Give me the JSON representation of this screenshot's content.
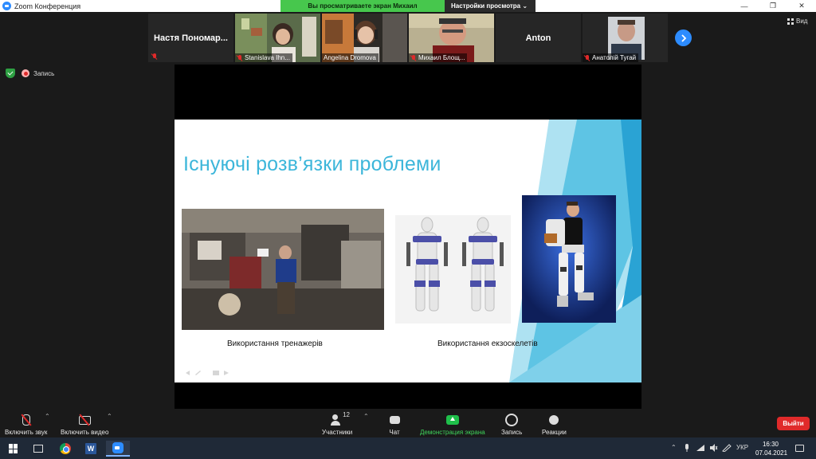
{
  "window": {
    "title": "Zoom Конференция",
    "minimize": "—",
    "maximize": "❐",
    "close": "✕"
  },
  "share_banner": {
    "text": "Вы просматриваете экран Михаил Блощицын",
    "view_options": "Настройки просмотра ⌄"
  },
  "participants": [
    {
      "name": "Настя Пономар..."
    },
    {
      "name": "Stanislava Ihn..."
    },
    {
      "name": "Angelina Dromova"
    },
    {
      "name": "Михаил Блощ..."
    },
    {
      "name": "Anton"
    },
    {
      "name": "Анатолій Тугай"
    }
  ],
  "view_button": "Вид",
  "status": {
    "recording": "Запись"
  },
  "slide": {
    "title": "Існуючі розв’язки проблеми",
    "caption_left": "Використання тренажерів",
    "caption_right": "Використання екзоскелетів"
  },
  "toolbar": {
    "audio": "Включить звук",
    "video": "Включить видео",
    "participants": "Участники",
    "participants_count": "12",
    "chat": "Чат",
    "share": "Демонстрация экрана",
    "record": "Запись",
    "reactions": "Реакции",
    "leave": "Выйти",
    "caret": "⌃"
  },
  "taskbar": {
    "word_letter": "W",
    "language": "УКР",
    "time": "16:30",
    "date": "07.04.2021"
  },
  "colors": {
    "accent": "#2d8cff",
    "share_green": "#47c74d",
    "leave_red": "#e02a2a",
    "slide_title": "#3cb6da"
  }
}
